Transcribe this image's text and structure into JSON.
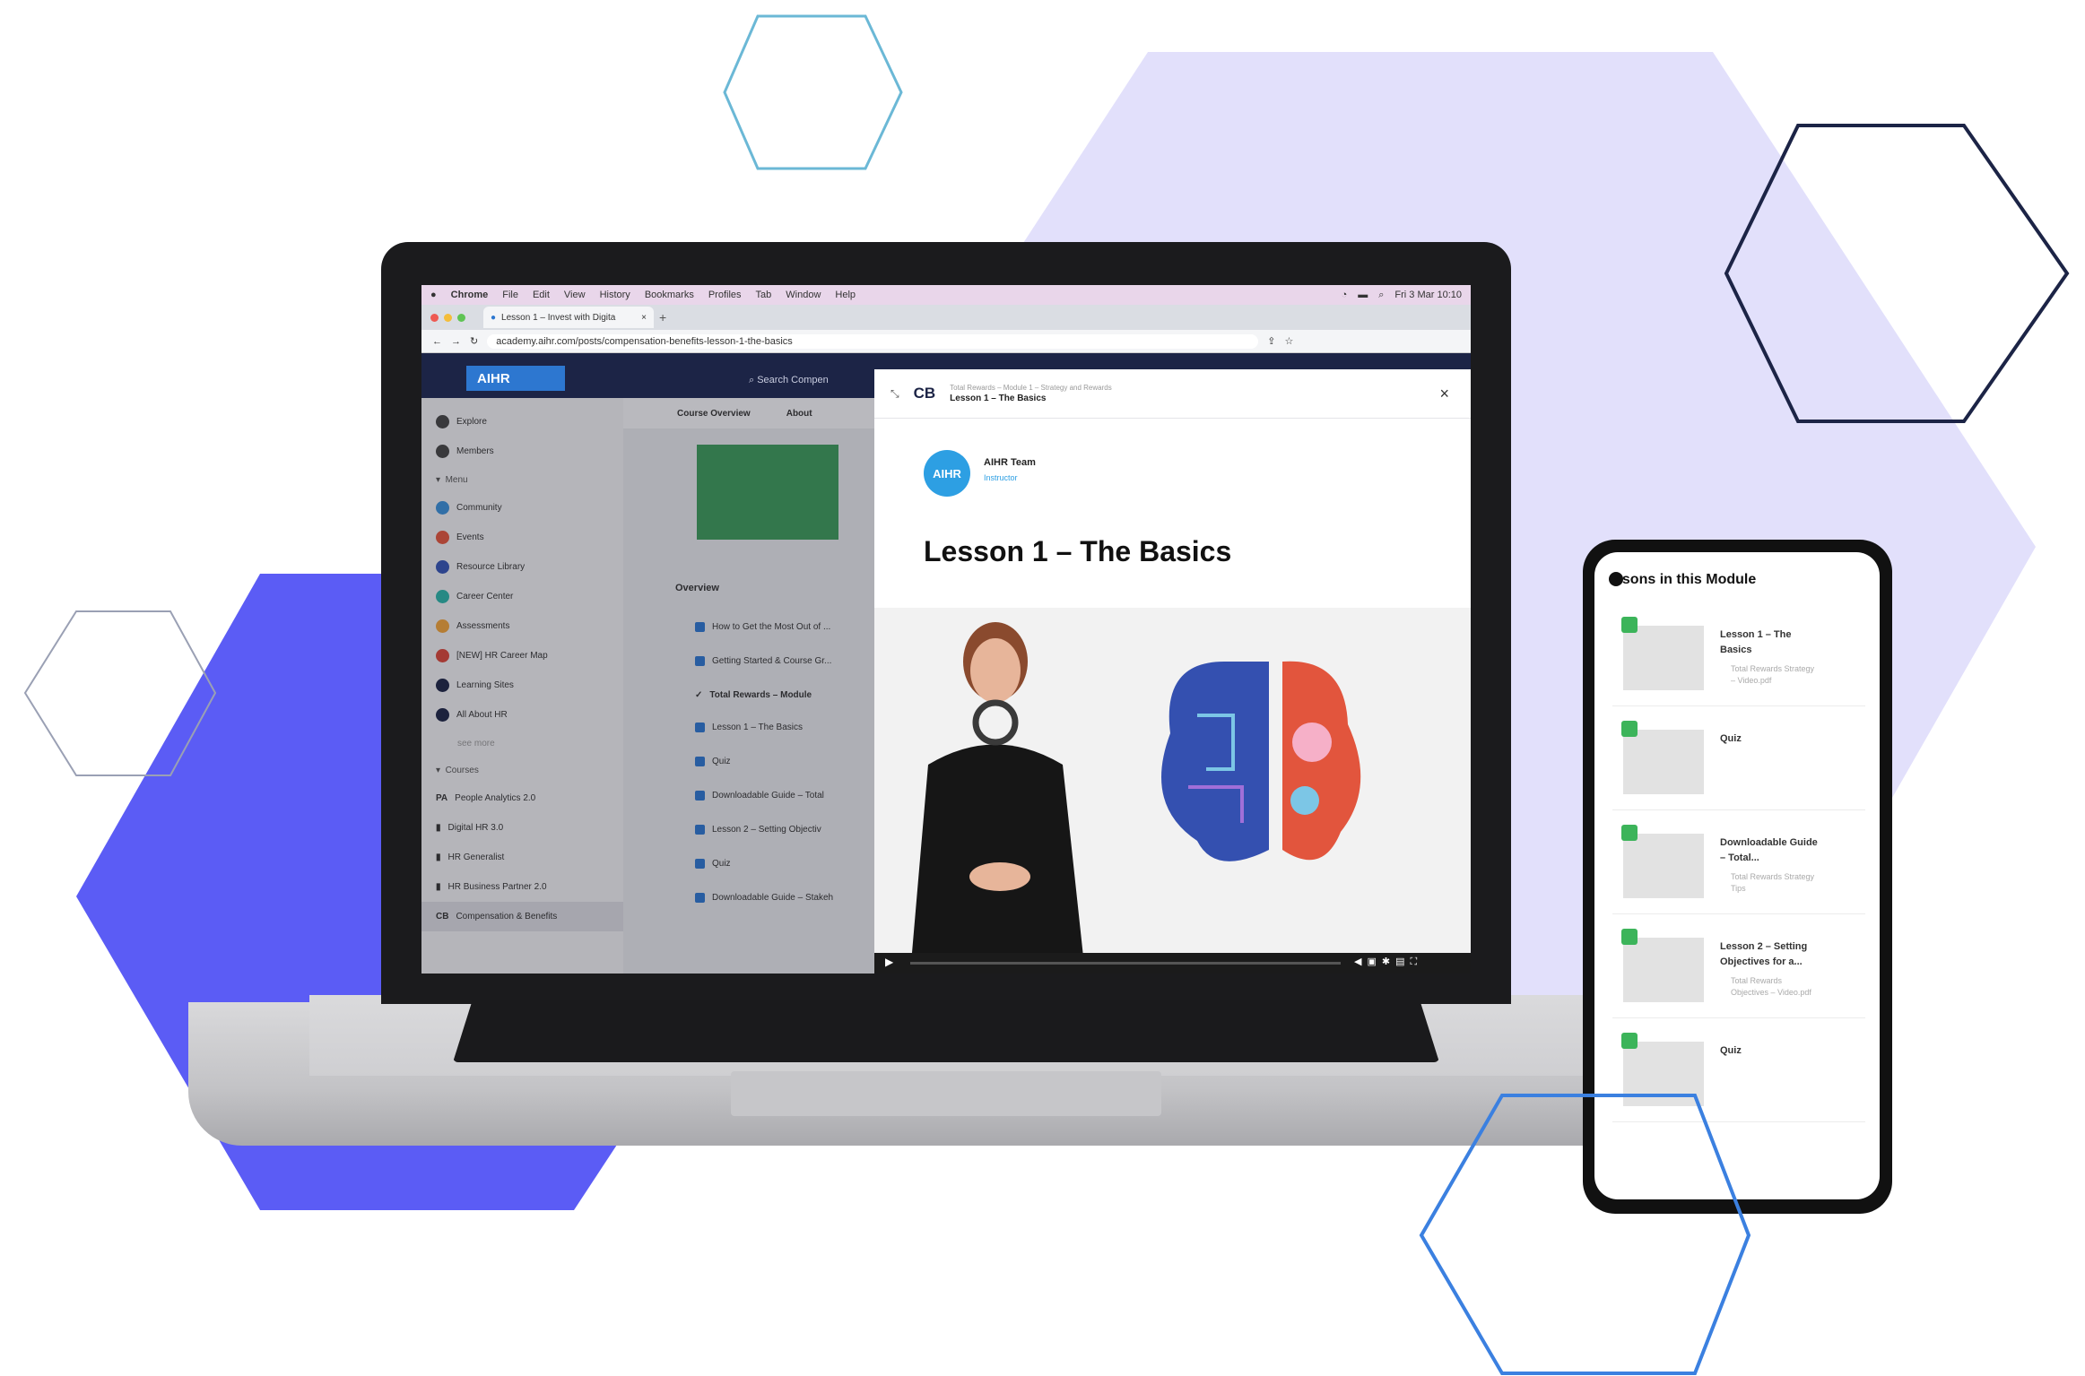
{
  "menubar": {
    "app": "Chrome",
    "items": [
      "File",
      "Edit",
      "View",
      "History",
      "Bookmarks",
      "Profiles",
      "Tab",
      "Window",
      "Help"
    ],
    "clock": "Fri 3 Mar 10:10"
  },
  "browser": {
    "tab_title": "Lesson 1 – Invest with Digita",
    "url": "academy.aihr.com/posts/compensation-benefits-lesson-1-the-basics"
  },
  "app": {
    "logo": "AIHR",
    "search_placeholder": "Search Compen",
    "sidebar": {
      "top": [
        "Explore",
        "Members"
      ],
      "menu_header": "Menu",
      "menu": [
        "Community",
        "Events",
        "Resource Library",
        "Career Center",
        "Assessments",
        "[NEW] HR Career Map",
        "Learning Sites",
        "All About HR"
      ],
      "see_more": "see more",
      "courses_header": "Courses",
      "courses": [
        "People Analytics 2.0",
        "Digital HR 3.0",
        "HR Generalist",
        "HR Business Partner 2.0",
        "Compensation & Benefits"
      ]
    },
    "main": {
      "tabs": [
        "Course Overview",
        "About"
      ],
      "section": "Overview",
      "items": [
        "How to Get the Most Out of ...",
        "Getting Started & Course Gr...",
        "Total Rewards – Module",
        "Lesson 1 – The Basics",
        "Quiz",
        "Downloadable Guide – Total",
        "Lesson 2 – Setting Objectiv",
        "Quiz",
        "Downloadable Guide – Stakeh"
      ]
    }
  },
  "lesson": {
    "badge": "CB",
    "breadcrumb": "Total Rewards – Module 1 – Strategy and Rewards",
    "header_title": "Lesson 1 – The Basics",
    "author": "AIHR Team",
    "role": "Instructor",
    "avatar_text": "AIHR",
    "title": "Lesson 1 – The Basics"
  },
  "phone": {
    "title": "ssons in this Module",
    "cards": [
      {
        "title": "Lesson 1 – The Basics",
        "sub": "Total Rewards Strategy – Video.pdf"
      },
      {
        "title": "Quiz",
        "sub": ""
      },
      {
        "title": "Downloadable Guide – Total...",
        "sub": "Total Rewards Strategy Tips"
      },
      {
        "title": "Lesson 2 – Setting Objectives for a...",
        "sub": "Total Rewards Objectives – Video.pdf"
      },
      {
        "title": "Quiz",
        "sub": ""
      }
    ]
  },
  "colors": {
    "accent": "#5b5cf5",
    "lavender": "#e2e0fb",
    "header": "#1c2446",
    "check": "#3cb45a"
  }
}
